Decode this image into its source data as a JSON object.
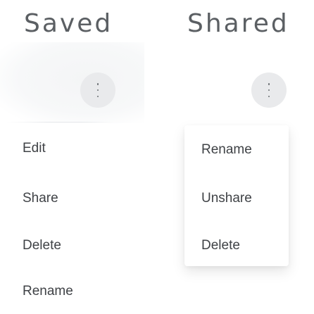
{
  "saved": {
    "title": "Saved",
    "more_button": {
      "icon": "vertical-ellipsis-icon"
    },
    "menu_items": [
      "Edit",
      "Share",
      "Delete",
      "Rename"
    ]
  },
  "shared": {
    "title": "Shared",
    "more_button": {
      "icon": "vertical-ellipsis-icon"
    },
    "menu_items": [
      "Rename",
      "Unshare",
      "Delete"
    ]
  },
  "colors": {
    "heading": "#5b5f63",
    "menu_text": "#3f4246",
    "button_bg": "#e9eaec"
  }
}
